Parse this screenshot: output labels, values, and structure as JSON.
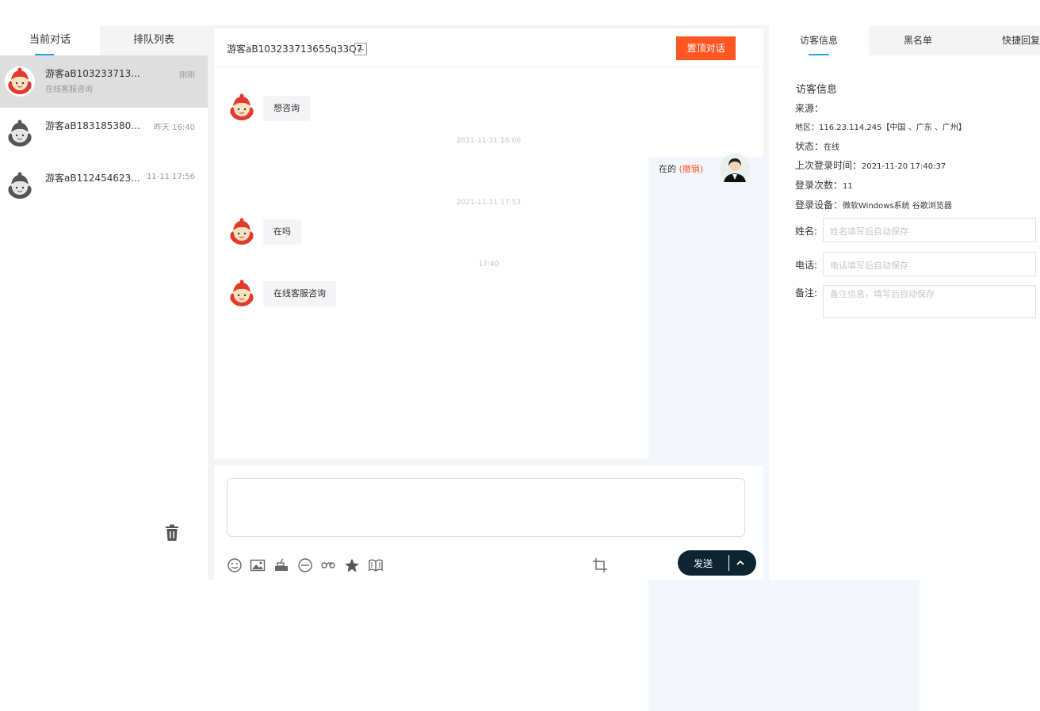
{
  "left_panel": {
    "tabs": [
      "当前对话",
      "排队列表"
    ],
    "conversations": [
      {
        "name": "游客aB103233713...",
        "time": "刚刚",
        "preview": "在线客服咨询",
        "active": true
      },
      {
        "name": "游客aB183185380...",
        "time": "昨天 16:40",
        "preview": "",
        "active": false
      },
      {
        "name": "游客aB112454623...",
        "time": "11-11 17:56",
        "preview": "",
        "active": false
      }
    ]
  },
  "chat": {
    "title": "游客aB103233713655q33Q7",
    "pin_button": "置顶对话",
    "messages": [
      {
        "side": "left",
        "text": "想咨询"
      },
      {
        "timestamp": "2021-11-11 16:06"
      },
      {
        "side": "right",
        "text": "在的",
        "recall": "(撤销)"
      },
      {
        "timestamp": "2021-11-11 17:53"
      },
      {
        "side": "left",
        "text": "在吗"
      },
      {
        "timestamp": "17:40"
      },
      {
        "side": "left",
        "text": "在线客服咨询"
      }
    ]
  },
  "input": {
    "send_label": "发送",
    "tools": [
      "emoji-icon",
      "image-icon",
      "cup-icon",
      "minus-circle-icon",
      "link-icon",
      "star-icon",
      "book-icon",
      "crop-icon"
    ]
  },
  "right_panel": {
    "tabs": [
      "访客信息",
      "黑名单",
      "快捷回复"
    ],
    "section_title": "访客信息",
    "info": {
      "source_label": "来源：",
      "source_value": "",
      "region_label": "地区：",
      "region_value": "116.23.114.245【中国 、广东 、广州】",
      "status_label": "状态：",
      "status_value": "在线",
      "last_login_label": "上次登录时间：",
      "last_login_value": "2021-11-20 17:40:37",
      "login_count_label": "登录次数：",
      "login_count_value": "11",
      "device_label": "登录设备：",
      "device_value": "微软Windows系统 谷歌浏览器"
    },
    "form": {
      "name_label": "姓名:",
      "name_placeholder": "姓名填写后自动保存",
      "phone_label": "电话:",
      "phone_placeholder": "电话填写后自动保存",
      "note_label": "备注:",
      "note_placeholder": "备注信息，填写后自动保存"
    }
  },
  "colors": {
    "accent_orange": "#ff5722",
    "tab_underline": "#21a8e0",
    "send_button": "#0d2533"
  }
}
